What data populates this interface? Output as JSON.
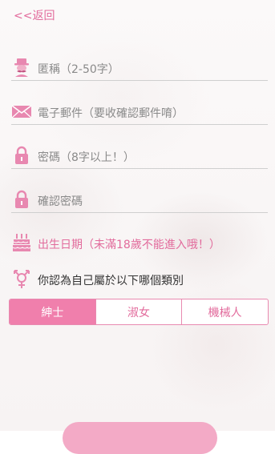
{
  "header": {
    "back_label": "<<返回"
  },
  "form": {
    "nickname_placeholder": "匿稱（2-50字）",
    "email_placeholder": "電子郵件（要收確認郵件唷）",
    "password_placeholder": "密碼（8字以上！）",
    "confirm_password_placeholder": "確認密碼",
    "birthday_label": "出生日期（未滿18歲不能進入哦！）",
    "gender_question": "你認為自己屬於以下哪個類別",
    "gender_options": [
      "紳士",
      "淑女",
      "機械人"
    ],
    "gender_selected": "紳士"
  },
  "icons": {
    "nickname": "gentleman-icon",
    "email": "envelope-icon",
    "password": "lock-icon",
    "confirm_password": "lock-icon",
    "birthday": "cake-icon",
    "gender": "gender-icon"
  },
  "colors": {
    "accent": "#e26b9c",
    "selected_bg": "#f07fac",
    "border": "#e88ab0",
    "icon_pink": "#e888b0"
  }
}
